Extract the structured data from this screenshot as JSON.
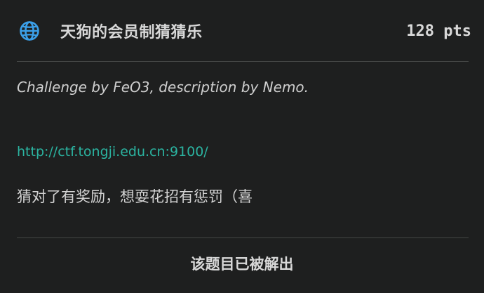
{
  "challenge": {
    "icon": "globe-icon",
    "title": "天狗的会员制猜猜乐",
    "points": "128 pts",
    "author": "Challenge by FeO3, description by Nemo.",
    "link": "http://ctf.tongji.edu.cn:9100/",
    "description": "猜对了有奖励，想耍花招有惩罚（喜",
    "status": "该题目已被解出"
  },
  "colors": {
    "background": "#1e1f1f",
    "accent_icon": "#3b9fe8",
    "link": "#2bb3a0",
    "divider": "#444645"
  }
}
